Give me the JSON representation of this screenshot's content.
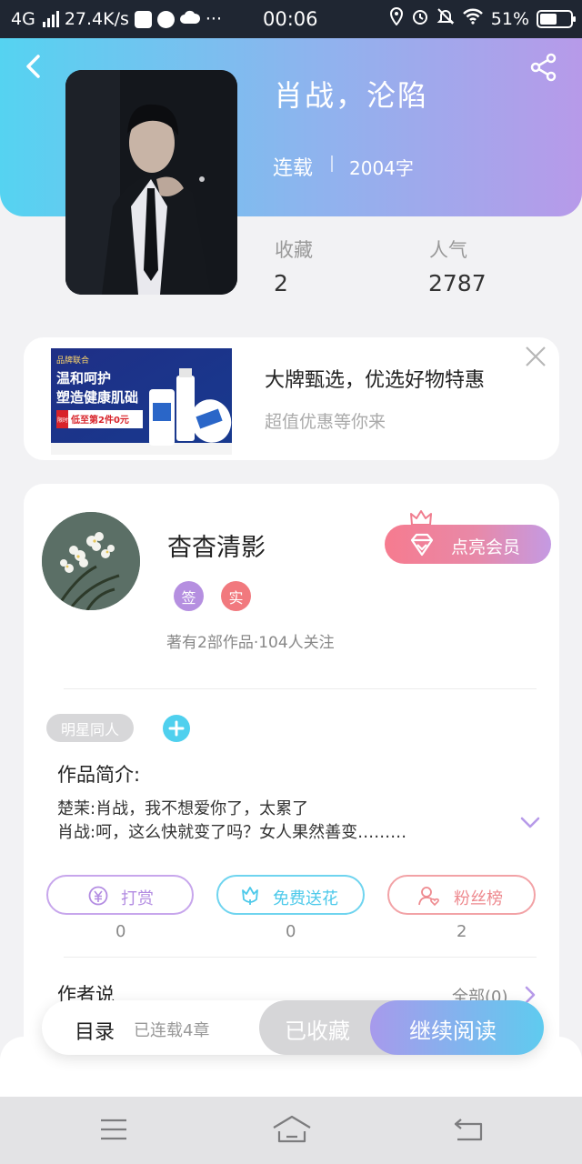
{
  "status_bar": {
    "network": "4G",
    "speed": "27.4K/s",
    "more": "···",
    "time": "00:06",
    "battery": "51%"
  },
  "book": {
    "title": "肖战，沦陷",
    "status": "连载",
    "word_count": "2004字",
    "stats": [
      {
        "label": "收藏",
        "value": "2"
      },
      {
        "label": "人气",
        "value": "2787"
      }
    ]
  },
  "ad": {
    "title": "大牌甄选，优选好物特惠",
    "subtitle": "超值优惠等你来",
    "image_text": {
      "brand": "品牌联合",
      "line1": "温和呵护",
      "line2": "塑造健康肌础",
      "promo_tag": "限时",
      "promo": "低至第2件0元"
    }
  },
  "author": {
    "name": "杳杳清影",
    "badges": [
      {
        "label": "签",
        "color": "#b58fe0"
      },
      {
        "label": "实",
        "color": "#f1797e"
      }
    ],
    "stats": "著有2部作品·104人关注",
    "vip_label": "点亮会员"
  },
  "tags": [
    "明星同人"
  ],
  "intro": {
    "label": "作品简介:",
    "lines": [
      "楚茉:肖战，我不想爱你了，太累了",
      "肖战:呵，这么快就变了吗？女人果然善变………"
    ]
  },
  "actions": [
    {
      "label": "打赏",
      "count": "0",
      "color": "#b38ce2"
    },
    {
      "label": "免费送花",
      "count": "0",
      "color": "#4cc9ea"
    },
    {
      "label": "粉丝榜",
      "count": "2",
      "color": "#ee8a8f"
    }
  ],
  "author_says": {
    "label": "作者说",
    "all_label": "全部(0)"
  },
  "bottom": {
    "catalog": "目录",
    "chapters": "已连载4章",
    "collected": "已收藏",
    "continue": "继续阅读"
  }
}
